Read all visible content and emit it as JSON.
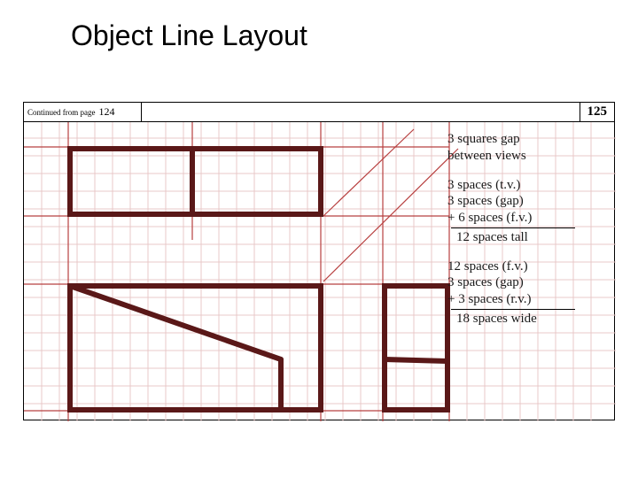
{
  "title": "Object Line Layout",
  "header": {
    "continued_label": "Continued from page",
    "continued_value": "124",
    "page_number": "125"
  },
  "annotations": {
    "block1": {
      "line1": "3 squares gap",
      "line2": "between views"
    },
    "block2": {
      "line1": "3 spaces (t.v.)",
      "line2": "3 spaces (gap)",
      "line3": "+ 6 spaces (f.v.)",
      "sum": "12 spaces tall"
    },
    "block3": {
      "line1": "12 spaces (f.v.)",
      "line2": "3 spaces (gap)",
      "line3": "+ 3 spaces (r.v.)",
      "sum": "18 spaces wide"
    }
  }
}
